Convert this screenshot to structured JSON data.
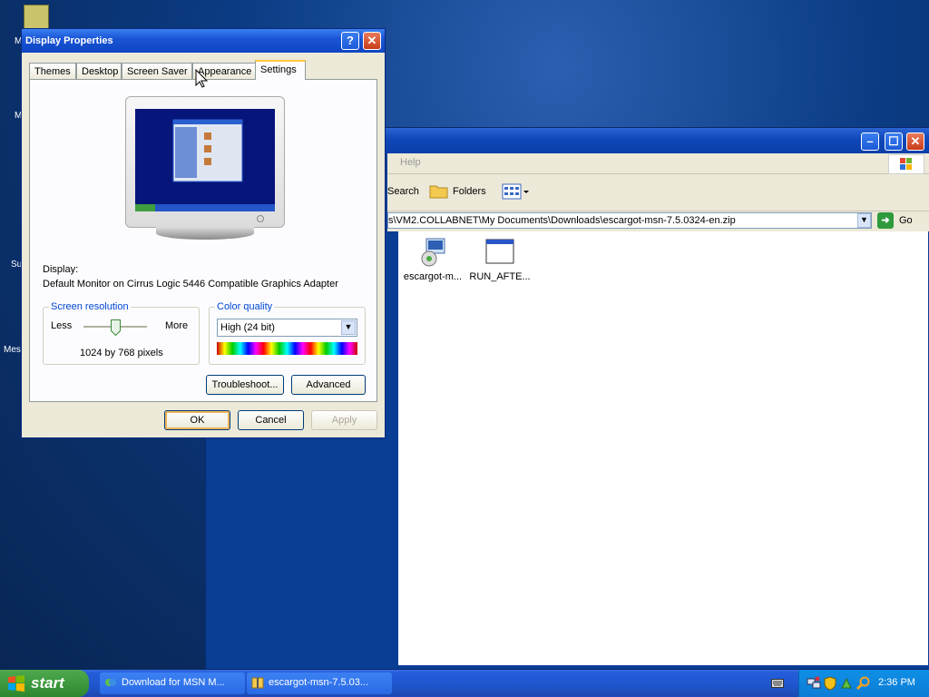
{
  "desktop": {
    "fragments": [
      "M",
      "M",
      "Su",
      "Mes"
    ]
  },
  "dialog": {
    "title": "Display Properties",
    "help_label": "?",
    "close_label": "✕",
    "tabs": [
      "Themes",
      "Desktop",
      "Screen Saver",
      "Appearance",
      "Settings"
    ],
    "active_tab": "Settings",
    "display_label": "Display:",
    "display_value": "Default Monitor on Cirrus Logic 5446 Compatible Graphics Adapter",
    "resolution": {
      "legend": "Screen resolution",
      "less": "Less",
      "more": "More",
      "value": "1024 by 768 pixels"
    },
    "color_quality": {
      "legend": "Color quality",
      "selected": "High (24 bit)"
    },
    "buttons": {
      "troubleshoot": "Troubleshoot...",
      "advanced": "Advanced",
      "ok": "OK",
      "cancel": "Cancel",
      "apply": "Apply"
    }
  },
  "explorer": {
    "menu_help": "Help",
    "toolbar": {
      "search": "Search",
      "folders": "Folders"
    },
    "address": "s\\VM2.COLLABNET\\My Documents\\Downloads\\escargot-msn-7.5.0324-en.zip",
    "go_label": "Go",
    "files": [
      {
        "name": "escargot-m...",
        "icon": "installer-icon"
      },
      {
        "name": "RUN_AFTE...",
        "icon": "application-window-icon"
      }
    ]
  },
  "taskbar": {
    "start_label": "start",
    "tasks": [
      {
        "label": "Download for MSN M...",
        "icon": "msn-icon"
      },
      {
        "label": "escargot-msn-7.5.03...",
        "icon": "zip-folder-icon"
      }
    ],
    "clock": "2:36 PM"
  },
  "colors": {
    "xp_blue_title": "#0e46c2",
    "dialog_bg": "#ece9d8",
    "start_green": "#3c9a3c",
    "tray_blue": "#0c7cd5"
  }
}
